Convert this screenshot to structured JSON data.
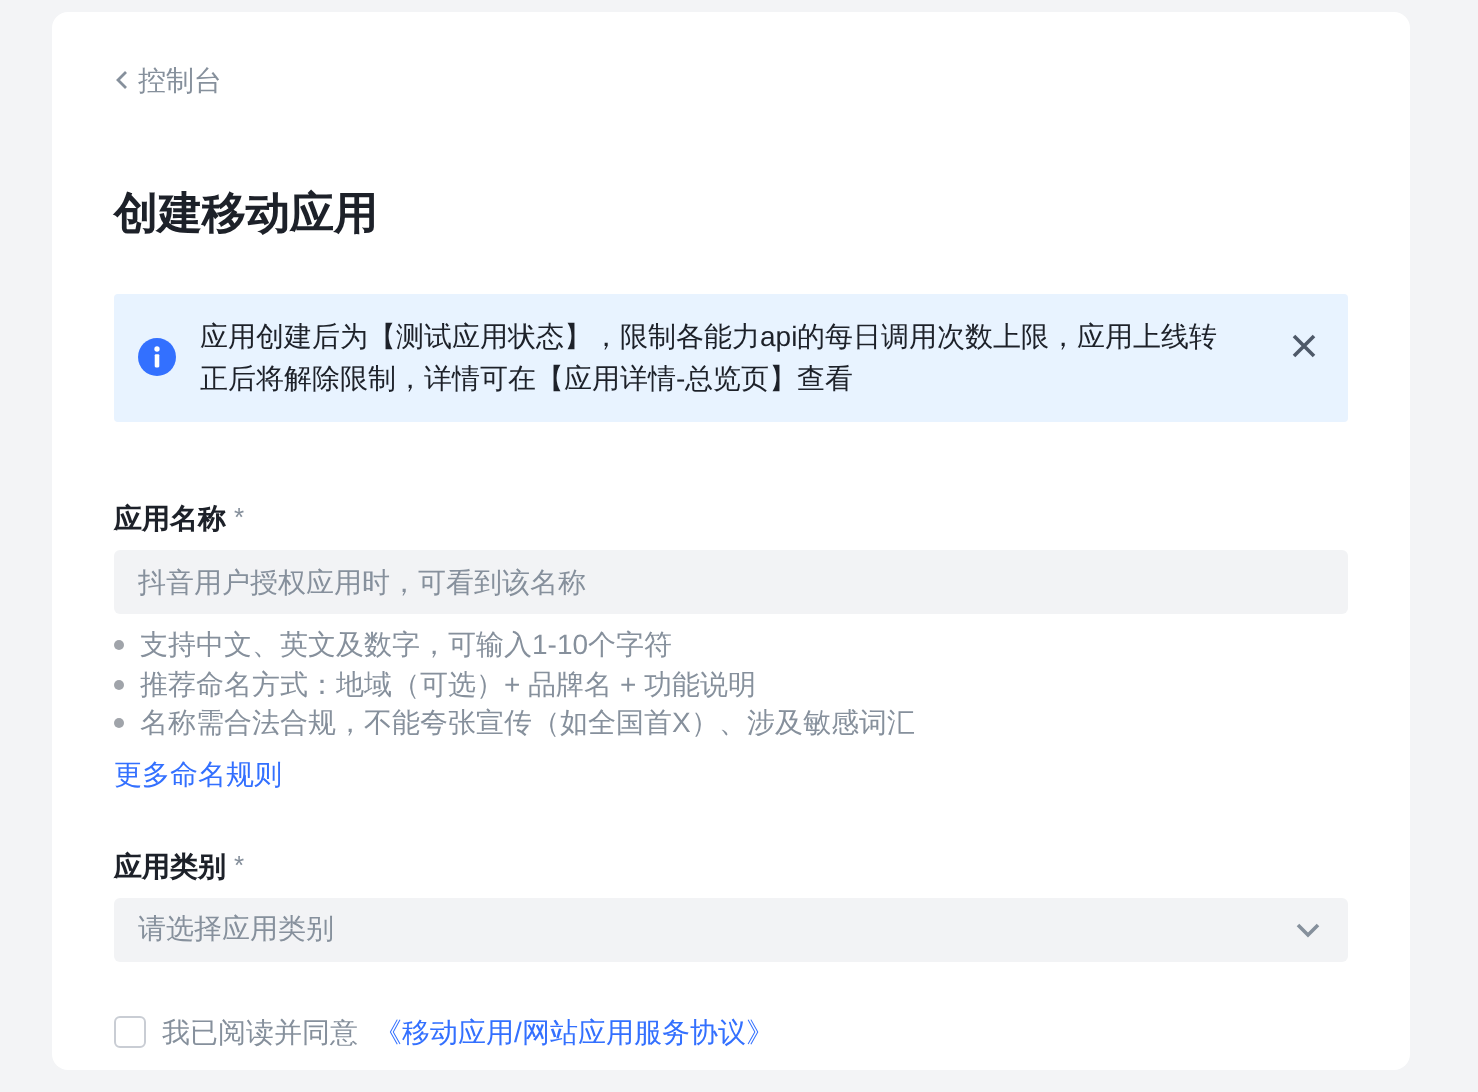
{
  "back_link": {
    "label": "控制台"
  },
  "title": "创建移动应用",
  "alert": {
    "text": "应用创建后为【测试应用状态】，限制各能力api的每日调用次数上限，应用上线转正后将解除限制，详情可在【应用详情-总览页】查看"
  },
  "fields": [
    {
      "kind": "text",
      "label": "应用名称",
      "required_mark": "*",
      "placeholder": "抖音用户授权应用时，可看到该名称",
      "hints": [
        "支持中文、英文及数字，可输入1-10个字符",
        "推荐命名方式：地域（可选）+ 品牌名 + 功能说明",
        "名称需合法合规，不能夸张宣传（如全国首X）、涉及敏感词汇"
      ],
      "link": "更多命名规则"
    },
    {
      "kind": "select",
      "label": "应用类别",
      "required_mark": "*",
      "placeholder": "请选择应用类别"
    }
  ],
  "agreement": {
    "checked": false,
    "text": "我已阅读并同意",
    "link": "《移动应用/网站应用服务协议》"
  }
}
